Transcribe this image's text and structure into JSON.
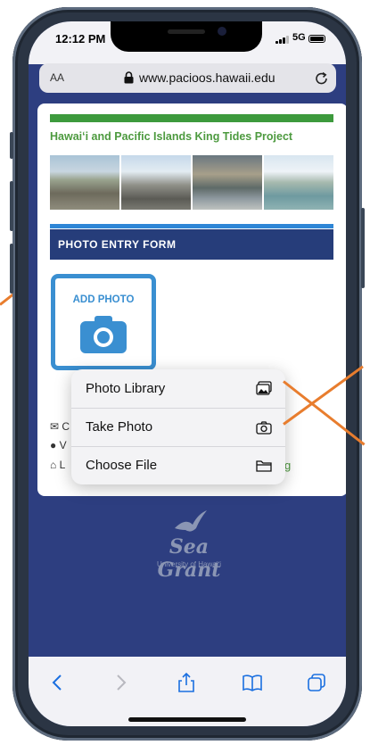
{
  "status_bar": {
    "time": "12:12 PM",
    "network": "5G"
  },
  "browser": {
    "text_size_label": "AA",
    "url": "www.pacioos.hawaii.edu"
  },
  "page": {
    "project_title": "Hawaiʻi and Pacific Islands King Tides Project",
    "form_title": "PHOTO ENTRY FORM",
    "add_photo_label": "ADD PHOTO",
    "info_rows": [
      "C",
      "V",
      "L"
    ],
    "link_fragment": "g"
  },
  "context_menu": {
    "items": [
      {
        "label": "Photo Library",
        "icon": "photo-library-icon"
      },
      {
        "label": "Take Photo",
        "icon": "camera-icon"
      },
      {
        "label": "Choose File",
        "icon": "folder-icon"
      }
    ]
  },
  "footer_logo": {
    "brand": "Sea Grant",
    "subtitle": "University of Hawaiʻi"
  },
  "colors": {
    "page_background": "#2d3e80",
    "title_green": "#4d9a3f",
    "form_header": "#263d7a",
    "accent_blue": "#3a8fd1",
    "annotation_arrow": "#e87d2e"
  }
}
